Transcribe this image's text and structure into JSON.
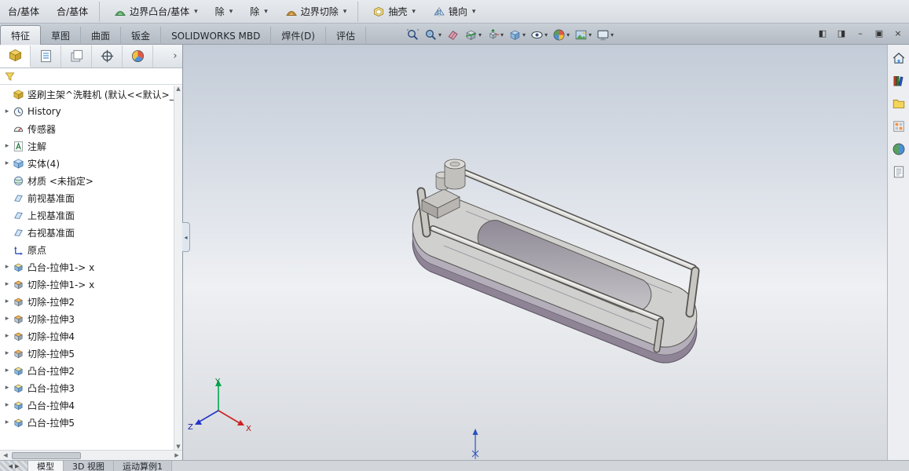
{
  "ribbon": {
    "caret": "▾",
    "items": [
      {
        "label": "台/基体",
        "dropdown": false
      },
      {
        "label": "合/基体",
        "dropdown": false,
        "sep": true
      },
      {
        "label": "边界凸台/基体",
        "sym": "s-boundary-boss",
        "dropdown": true
      },
      {
        "label": "除",
        "dropdown": true
      },
      {
        "label": "除",
        "dropdown": true
      },
      {
        "label": "边界切除",
        "sym": "s-boundary-cut",
        "dropdown": true,
        "sep": true
      },
      {
        "label": "抽壳",
        "sym": "s-shell",
        "dropdown": true
      },
      {
        "label": "镜向",
        "sym": "s-mirror",
        "dropdown": true
      }
    ]
  },
  "tabs": [
    {
      "label": "特征",
      "active": true
    },
    {
      "label": "草图"
    },
    {
      "label": "曲面"
    },
    {
      "label": "钣金"
    },
    {
      "label": "SOLIDWORKS MBD"
    },
    {
      "label": "焊件(D)"
    },
    {
      "label": "评估"
    }
  ],
  "hud": {
    "caret": "▾",
    "items": [
      {
        "name": "zoom-to-fit",
        "sym": "s-zoomfit",
        "dropdown": false
      },
      {
        "name": "zoom-to-area",
        "sym": "s-zoomarea",
        "dropdown": true
      },
      {
        "name": "previous-view",
        "sym": "s-eraser",
        "dropdown": false
      },
      {
        "name": "section-view",
        "sym": "s-section",
        "dropdown": true
      },
      {
        "name": "view-orientation",
        "sym": "s-vieworient",
        "dropdown": true
      },
      {
        "name": "display-style",
        "sym": "s-displaystyle",
        "dropdown": true
      },
      {
        "name": "hide-show-items",
        "sym": "s-hideshow",
        "dropdown": true
      },
      {
        "name": "edit-appearance",
        "sym": "s-appearance",
        "dropdown": true
      },
      {
        "name": "apply-scene",
        "sym": "s-scene",
        "dropdown": true
      },
      {
        "name": "view-settings",
        "sym": "s-monitor",
        "dropdown": true
      }
    ]
  },
  "window": {
    "controls": [
      {
        "name": "show-left-pane-button",
        "glyph": "◧"
      },
      {
        "name": "show-right-pane-button",
        "glyph": "◨"
      },
      {
        "name": "minimize-button",
        "glyph": "–"
      },
      {
        "name": "restore-button",
        "glyph": "▣"
      },
      {
        "name": "close-button",
        "glyph": "×"
      }
    ]
  },
  "panel": {
    "overflow_glyph": "›",
    "tabs": [
      {
        "name": "featuremanager-tab",
        "sym": "s-part",
        "active": true
      },
      {
        "name": "propertymanager-tab",
        "sym": "s-pm-prop"
      },
      {
        "name": "configurationmanager-tab",
        "sym": "s-pm-config"
      },
      {
        "name": "dimxpertmanager-tab",
        "sym": "s-pm-dimxpert"
      },
      {
        "name": "displaymanager-tab",
        "sym": "s-pm-display"
      }
    ]
  },
  "tree": {
    "arrow_glyph": "▸",
    "root": "竖刷主架^洗鞋机 (默认<<默认>_显",
    "items": [
      {
        "label": "History",
        "sym": "s-history",
        "arrow": true
      },
      {
        "label": "传感器",
        "sym": "s-sensors",
        "arrow": false
      },
      {
        "label": "注解",
        "sym": "s-annotations",
        "arrow": true
      },
      {
        "label": "实体(4)",
        "sym": "s-solid-bodies",
        "arrow": true
      },
      {
        "label": "材质 <未指定>",
        "sym": "s-material",
        "arrow": false
      },
      {
        "label": "前视基准面",
        "sym": "s-plane",
        "arrow": false
      },
      {
        "label": "上视基准面",
        "sym": "s-plane",
        "arrow": false
      },
      {
        "label": "右视基准面",
        "sym": "s-plane",
        "arrow": false
      },
      {
        "label": "原点",
        "sym": "s-origin",
        "arrow": false
      },
      {
        "label": "凸台-拉伸1-> x",
        "sym": "s-boss-extrude",
        "arrow": true
      },
      {
        "label": "切除-拉伸1-> x",
        "sym": "s-cut-extrude",
        "arrow": true
      },
      {
        "label": "切除-拉伸2",
        "sym": "s-cut-extrude",
        "arrow": true
      },
      {
        "label": "切除-拉伸3",
        "sym": "s-cut-extrude",
        "arrow": true
      },
      {
        "label": "切除-拉伸4",
        "sym": "s-cut-extrude",
        "arrow": true
      },
      {
        "label": "切除-拉伸5",
        "sym": "s-cut-extrude",
        "arrow": true
      },
      {
        "label": "凸台-拉伸2",
        "sym": "s-boss-extrude",
        "arrow": true
      },
      {
        "label": "凸台-拉伸3",
        "sym": "s-boss-extrude",
        "arrow": true
      },
      {
        "label": "凸台-拉伸4",
        "sym": "s-boss-extrude",
        "arrow": true
      },
      {
        "label": "凸台-拉伸5",
        "sym": "s-boss-extrude",
        "arrow": true
      }
    ]
  },
  "scrollbar": {
    "up": "▲",
    "down": "▼",
    "left": "◀",
    "right": "▶"
  },
  "collapse_glyph": "◂",
  "taskpane": {
    "items": [
      {
        "name": "home",
        "sym": "s-home"
      },
      {
        "name": "design-library",
        "sym": "s-lib"
      },
      {
        "name": "file-explorer",
        "sym": "s-folder"
      },
      {
        "name": "view-palette",
        "sym": "s-palette"
      },
      {
        "name": "appearances-scenes",
        "sym": "s-ball"
      },
      {
        "name": "custom-properties",
        "sym": "s-props"
      }
    ]
  },
  "statusbar": {
    "tabs": [
      {
        "label": "模型",
        "active": true
      },
      {
        "label": "3D 视图"
      },
      {
        "label": "运动算例1"
      }
    ]
  },
  "triad": {
    "x": "X",
    "y": "Y",
    "z": "Z"
  },
  "colors": {
    "viewport_top": "#c3ccd8",
    "viewport_mid": "#eef0f3",
    "viewport_bottom": "#d6d9de",
    "model_fill": "#d0d0ce",
    "model_shadow": "#8e8496",
    "triad_x": "#cc2222",
    "triad_y": "#00a651",
    "triad_z": "#2233cc"
  }
}
